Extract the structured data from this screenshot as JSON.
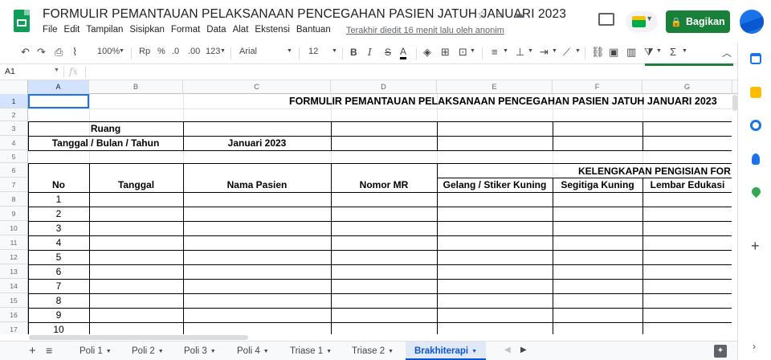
{
  "app": {
    "doc_title": "FORMULIR PEMANTAUAN PELAKSANAAN PENCEGAHAN PASIEN JATUH JANUARI 2023",
    "last_edit": "Terakhir diedit 16 menit lalu oleh anonim",
    "share_label": "Bagikan",
    "menu": [
      "File",
      "Edit",
      "Tampilan",
      "Sisipkan",
      "Format",
      "Data",
      "Alat",
      "Ekstensi",
      "Bantuan"
    ]
  },
  "toolbar": {
    "zoom": "100%",
    "currency": "Rp",
    "percent": "%",
    "decrease_decimal": ".0",
    "increase_decimal": ".00",
    "more_formats": "123",
    "font": "Arial",
    "font_size": "12",
    "bold": "B",
    "italic": "I",
    "strikethrough": "S",
    "text_color": "A"
  },
  "formula_bar": {
    "cell_ref": "A1",
    "fx": "fx"
  },
  "columns": [
    "A",
    "B",
    "C",
    "D",
    "E",
    "F",
    "G"
  ],
  "rows": [
    "1",
    "2",
    "3",
    "4",
    "5",
    "6",
    "7",
    "8",
    "9",
    "10",
    "11",
    "12",
    "13",
    "14",
    "15",
    "16",
    "17"
  ],
  "sheet": {
    "title": "FORMULIR PEMANTAUAN PELAKSANAAN PENCEGAHAN PASIEN JATUH JANUARI 2023",
    "ruang_label": "Ruang",
    "date_label": "Tanggal / Bulan / Tahun",
    "date_value": "Januari 2023",
    "kelengkapan": "KELENGKAPAN PENGISIAN FOR",
    "headers": {
      "no": "No",
      "tanggal": "Tanggal",
      "nama": "Nama Pasien",
      "mr": "Nomor MR",
      "gelang": "Gelang / Stiker Kuning",
      "segitiga": "Segitiga Kuning",
      "lembar": "Lembar Edukasi"
    },
    "numbers": [
      "1",
      "2",
      "3",
      "4",
      "5",
      "6",
      "7",
      "8",
      "9",
      "10"
    ]
  },
  "tabs": [
    {
      "label": "Poli 1",
      "active": false
    },
    {
      "label": "Poli 2",
      "active": false
    },
    {
      "label": "Poli 3",
      "active": false
    },
    {
      "label": "Poli 4",
      "active": false
    },
    {
      "label": "Triase 1",
      "active": false
    },
    {
      "label": "Triase 2",
      "active": false
    },
    {
      "label": "Brakhiterapi",
      "active": true
    }
  ],
  "colors": {
    "share": "#188038",
    "active_tab": "#0b57d0",
    "selection": "#1a73e8"
  }
}
